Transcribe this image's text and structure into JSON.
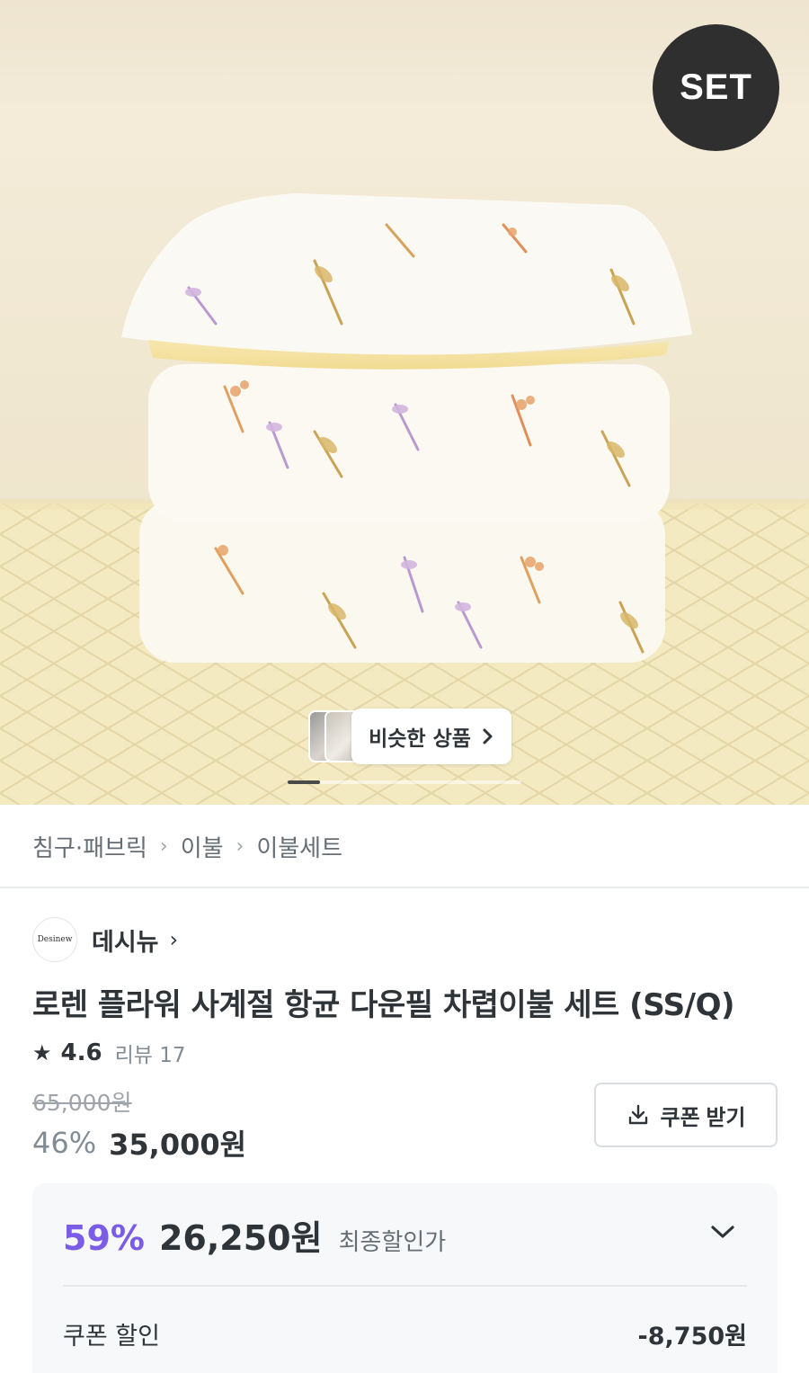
{
  "hero": {
    "badge": "SET",
    "similar_products": {
      "label": "비슷한 상품",
      "chevron": "›"
    }
  },
  "breadcrumb": {
    "items": [
      "침구·패브릭",
      "이불",
      "이불세트"
    ],
    "separator": "›"
  },
  "brand": {
    "logo_text": "Desinew",
    "name": "데시뉴",
    "chevron": "›"
  },
  "product": {
    "title": "로렌 플라워 사계절 항균 다운필 차렵이불 세트 (SS/Q)",
    "rating": {
      "star": "★",
      "score": "4.6",
      "review_label": "리뷰 17"
    }
  },
  "price": {
    "original": "65,000원",
    "discount_pct": "46%",
    "sale": "35,000원",
    "coupon_button": "쿠폰 받기"
  },
  "final_price": {
    "discount_pct": "59%",
    "price": "26,250원",
    "label": "최종할인가",
    "coupon_discount_label": "쿠폰 할인",
    "coupon_discount_value": "-8,750원"
  },
  "colors": {
    "accent_purple": "#7b5ce6",
    "text_primary": "#2f3438",
    "text_secondary": "#828c94",
    "badge_bg": "#2f2f2f"
  },
  "icons": [
    "download-icon",
    "chevron-down-icon",
    "chevron-right-icon",
    "star-icon"
  ]
}
